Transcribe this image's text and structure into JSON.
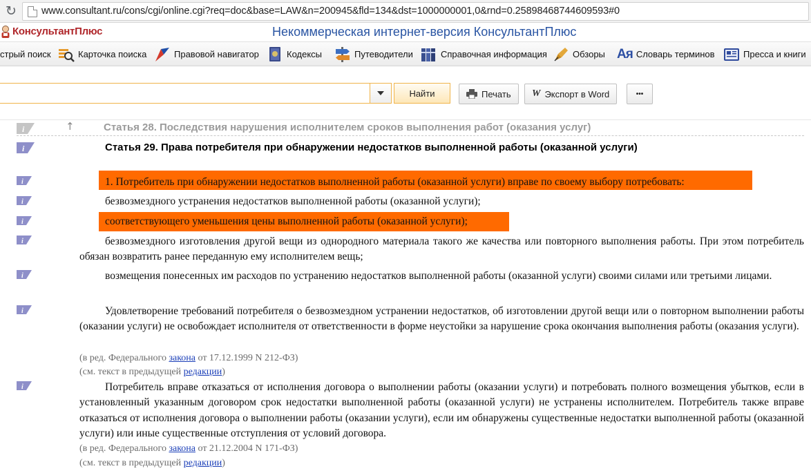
{
  "browser": {
    "url": "www.consultant.ru/cons/cgi/online.cgi?req=doc&base=LAW&n=200945&fld=134&dst=1000000001,0&rnd=0.25898468744609593#0"
  },
  "brand": {
    "logo_text": "КонсультантПлюс",
    "site_title": "Некоммерческая интернет-версия КонсультантПлюс"
  },
  "nav": {
    "items": [
      {
        "label": "стрый поиск",
        "icon": "quick-search-icon"
      },
      {
        "label": "Карточка поиска",
        "icon": "search-card-icon"
      },
      {
        "label": "Правовой навигатор",
        "icon": "legal-navigator-icon"
      },
      {
        "label": "Кодексы",
        "icon": "codes-icon"
      },
      {
        "label": "Путеводители",
        "icon": "guides-icon"
      },
      {
        "label": "Справочная информация",
        "icon": "reference-icon"
      },
      {
        "label": "Обзоры",
        "icon": "reviews-icon"
      },
      {
        "label": "Словарь терминов",
        "icon": "dictionary-icon"
      },
      {
        "label": "Пресса и книги",
        "icon": "press-icon"
      }
    ]
  },
  "search": {
    "value": "",
    "find_label": "Найти",
    "print_label": "Печать",
    "export_label": "Экспорт в Word",
    "more_label": "•••"
  },
  "document": {
    "prev_heading": "Статья 28. Последствия нарушения исполнителем сроков выполнения работ (оказания услуг)",
    "heading": "Статья 29. Права потребителя при обнаружении недостатков выполненной работы (оказанной услуги)",
    "paragraphs": [
      "1. Потребитель при обнаружении недостатков выполненной работы (оказанной услуги) вправе по своему выбору потребовать:",
      "безвозмездного устранения недостатков выполненной работы (оказанной услуги);",
      "соответствующего уменьшения цены выполненной работы (оказанной услуги);",
      "безвозмездного изготовления другой вещи из однородного материала такого же качества или повторного выполнения работы. При этом потребитель обязан возвратить ранее переданную ему исполнителем вещь;",
      "возмещения понесенных им расходов по устранению недостатков выполненной работы (оказанной услуги) своими силами или третьими лицами.",
      "Удовлетворение требований потребителя о безвозмездном устранении недостатков, об изготовлении другой вещи или о повторном выполнении работы (оказании услуги) не освобождает исполнителя от ответственности в форме неустойки за нарушение срока окончания выполнения работы (оказания услуги).",
      "Потребитель вправе отказаться от исполнения договора о выполнении работы (оказании услуги) и потребовать полного возмещения убытков, если в установленный указанным договором срок недостатки выполненной работы (оказанной услуги) не устранены исполнителем. Потребитель также вправе отказаться от исполнения договора о выполнении работы (оказании услуги), если им обнаружены существенные недостатки выполненной работы (оказанной услуги) или иные существенные отступления от условий договора."
    ],
    "notes": [
      {
        "before": "(в ред. Федерального ",
        "link": "закона",
        "after": " от 17.12.1999 N 212-ФЗ)"
      },
      {
        "before": "(см. текст в предыдущей ",
        "link": "редакции",
        "after": ")"
      },
      {
        "before": "(в ред. Федерального ",
        "link": "закона",
        "after": " от 21.12.2004 N 171-ФЗ)"
      },
      {
        "before": "(см. текст в предыдущей ",
        "link": "редакции",
        "after": ")"
      }
    ],
    "highlight_color": "#ff6a00"
  }
}
